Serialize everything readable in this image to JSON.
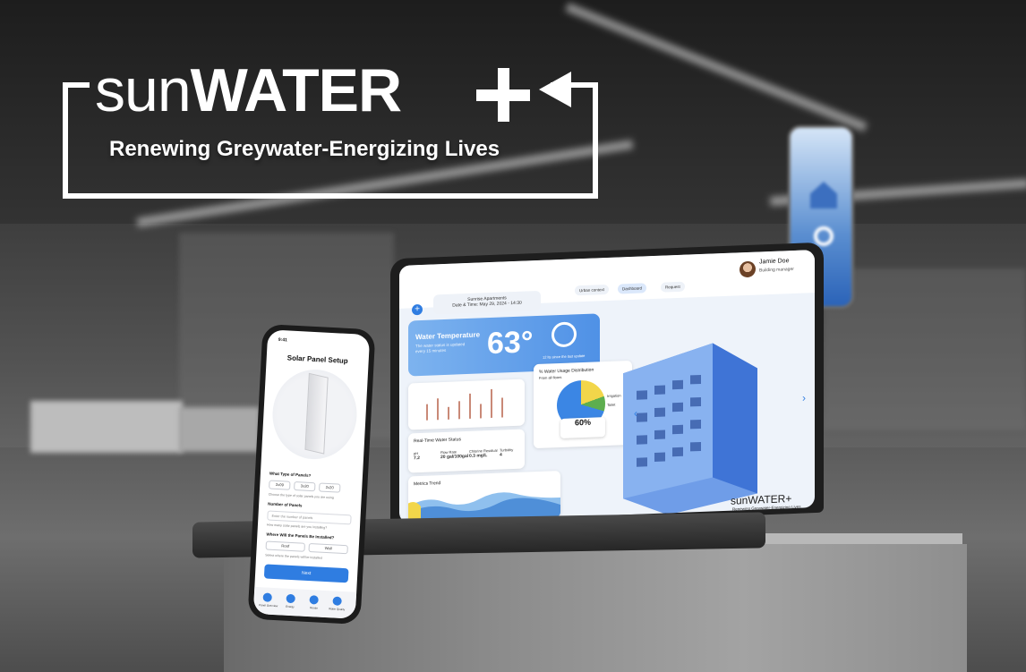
{
  "brand": {
    "logo_thin": "sun",
    "logo_bold": "WATER",
    "tagline": "Renewing Greywater-Energizing Lives"
  },
  "dashboard": {
    "building_name": "Sunrise Apartments",
    "datetime": "Date & Time: May 29, 2024 - 14:30",
    "nav": [
      "Urban context",
      "Dashboard",
      "Request"
    ],
    "user": {
      "name": "Jamie Doe",
      "role": "Building manager"
    },
    "water_temp": {
      "label": "Water Temperature",
      "subtitle": "The water status is updated every 15 minutes",
      "value": "63°",
      "drop_caption": "12 lts since the last update"
    },
    "usage": {
      "title": "% Water Usage Distribution",
      "subtitle": "From all floors",
      "percent": "60%",
      "legend": [
        "Irrigation",
        "Toilet"
      ]
    },
    "realtime": {
      "title": "Real-Time Water Status",
      "metrics": [
        {
          "label": "pH",
          "value": "7.2"
        },
        {
          "label": "Flow Rate",
          "value": "20 gal/100gal"
        },
        {
          "label": "Chlorine Residual",
          "value": "0.3 mg/L"
        },
        {
          "label": "Turbidity",
          "value": "4"
        }
      ]
    },
    "trend_title": "Metrics Trend",
    "mini_logo": "sunWATER+",
    "mini_tagline": "Renewing Greywater-Energizing Lives"
  },
  "phone": {
    "status_time": "9:41",
    "title": "Solar Panel Setup",
    "q_type": "What Type of Panels?",
    "type_options": [
      "2x09",
      "3x20",
      "2x20"
    ],
    "type_hint": "Choose the type of solar panels you are using",
    "q_number": "Number of Panels",
    "number_placeholder": "Enter the number of panels",
    "number_hint": "How many solar panels are you installing?",
    "q_where": "Where Will the Panels Be Installed?",
    "where_options": [
      "Roof",
      "Wall"
    ],
    "where_hint": "Select where the panels will be installed",
    "next_label": "Next",
    "tabs": [
      "Panel Overview",
      "Energy",
      "Reuse",
      "Water Quality"
    ]
  },
  "colors": {
    "accent": "#2f7de1",
    "temp_card": "#4f91e6"
  }
}
